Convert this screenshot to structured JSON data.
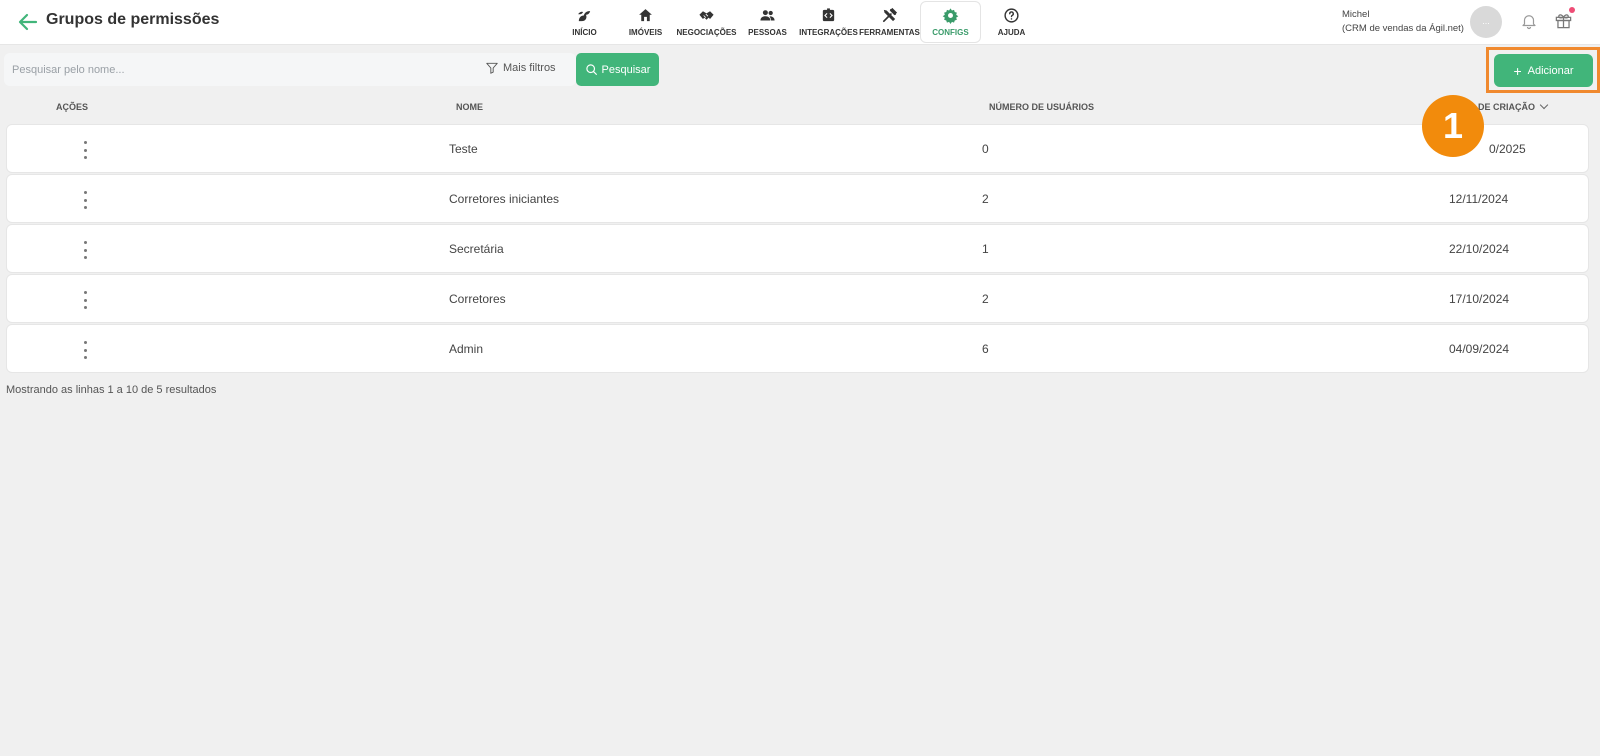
{
  "header": {
    "title": "Grupos de permissões",
    "nav": [
      {
        "label": "INÍCIO",
        "icon": "squirrel-icon",
        "active": false
      },
      {
        "label": "IMÓVEIS",
        "icon": "home-icon",
        "active": false
      },
      {
        "label": "NEGOCIAÇÕES",
        "icon": "handshake-icon",
        "active": false
      },
      {
        "label": "PESSOAS",
        "icon": "people-icon",
        "active": false
      },
      {
        "label": "INTEGRAÇÕES",
        "icon": "integration-icon",
        "active": false
      },
      {
        "label": "FERRAMENTAS",
        "icon": "tools-icon",
        "active": false
      },
      {
        "label": "CONFIGS",
        "icon": "gear-icon",
        "active": true
      },
      {
        "label": "AJUDA",
        "icon": "help-icon",
        "active": false
      }
    ],
    "user": {
      "name": "Michel",
      "company": "(CRM de vendas da Ágil.net)",
      "avatar_text": "..."
    }
  },
  "toolbar": {
    "search_placeholder": "Pesquisar pelo nome...",
    "filters_label": "Mais filtros",
    "search_button": "Pesquisar",
    "add_button": "Adicionar",
    "step_number": "1"
  },
  "table": {
    "columns": [
      "AÇÕES",
      "NOME",
      "NÚMERO DE USUÁRIOS",
      "DE CRIAÇÃO"
    ],
    "rows": [
      {
        "name": "Teste",
        "users": "0",
        "created": "0/2025"
      },
      {
        "name": "Corretores iniciantes",
        "users": "2",
        "created": "12/11/2024"
      },
      {
        "name": "Secretária",
        "users": "1",
        "created": "22/10/2024"
      },
      {
        "name": "Corretores",
        "users": "2",
        "created": "17/10/2024"
      },
      {
        "name": "Admin",
        "users": "6",
        "created": "04/09/2024"
      }
    ]
  },
  "footer": {
    "summary": "Mostrando as linhas 1 a 10 de 5 resultados"
  },
  "colors": {
    "accent": "#41b57a",
    "highlight": "#f0892e",
    "badge": "#f28b0c",
    "active_nav": "#3a9b6a"
  }
}
